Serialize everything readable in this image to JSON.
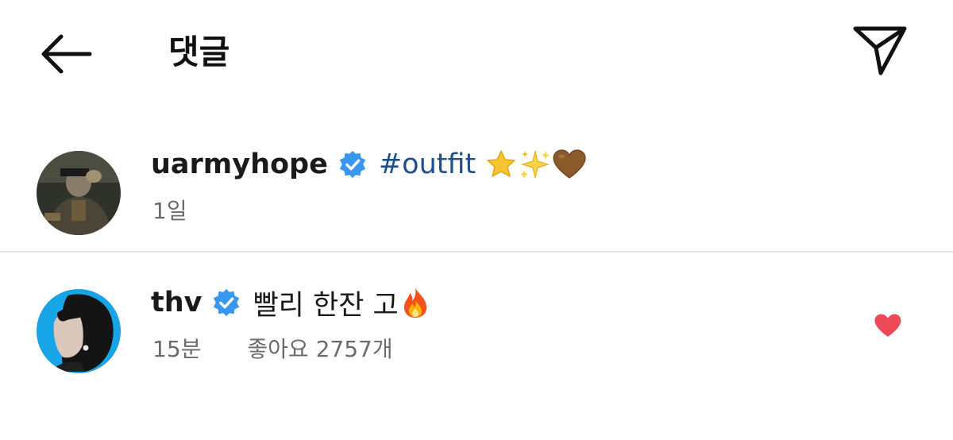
{
  "header": {
    "title": "댓글",
    "back_icon": "arrow-left-icon",
    "share_icon": "paper-plane-icon"
  },
  "comments": [
    {
      "username": "uarmyhope",
      "verified": true,
      "hashtag": "#outfit",
      "text": "",
      "emojis": [
        "star",
        "sparkles",
        "brown-heart"
      ],
      "time": "1일",
      "likes": ""
    },
    {
      "username": "thv",
      "verified": true,
      "hashtag": "",
      "text": "빨리 한잔 고",
      "emojis": [
        "fire"
      ],
      "time": "15분",
      "likes": "좋아요 2757개",
      "liked": true
    }
  ],
  "colors": {
    "verified_badge": "#3897f0",
    "hashtag": "#1f4e8c",
    "liked_heart": "#ed4956",
    "meta_text": "#6b6b6b",
    "divider": "#e6e6e6"
  }
}
